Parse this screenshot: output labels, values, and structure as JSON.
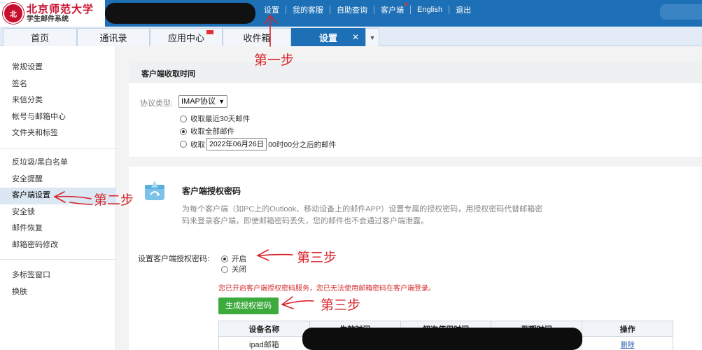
{
  "logo": {
    "title": "北京师范大学",
    "subtitle": "学生邮件系统"
  },
  "topnav": [
    "设置",
    "我的客服",
    "自助查询",
    "客户端",
    "English",
    "退出"
  ],
  "tabs": [
    "首页",
    "通讯录",
    "应用中心",
    "收件箱",
    "设置"
  ],
  "sidebar": {
    "group1": [
      "常规设置",
      "签名",
      "来信分类",
      "帐号与邮箱中心",
      "文件夹和标签"
    ],
    "group2": [
      "反垃圾/黑白名单",
      "安全提醒",
      "客户端设置",
      "安全锁",
      "邮件恢复",
      "邮箱密码修改"
    ],
    "group3": [
      "多标签窗口",
      "换肤"
    ]
  },
  "receive": {
    "header": "客户端收取时间",
    "protocol_label": "协议类型:",
    "protocol_value": "IMAP协议",
    "option1": "收取最近30天邮件",
    "option2": "收取全部邮件",
    "option3_prefix": "收取",
    "option3_date": "2022年06月26日",
    "option3_suffix": "00时00分之后的邮件"
  },
  "auth": {
    "title": "客户端授权密码",
    "description": "为每个客户端（如PC上的Outlook、移动设备上的邮件APP）设置专属的授权密码，用授权密码代替邮箱密码来登录客户端，即使邮箱密码丢失，您的邮件也不会通过客户端泄露。",
    "setting_label": "设置客户端授权密码:",
    "on": "开启",
    "off": "关闭",
    "notice": "您已开启客户端授权密码服务，您已无法使用邮箱密码在客户端登录。",
    "generate_button": "生成授权密码"
  },
  "table": {
    "headers": [
      "设备名称",
      "生效时间",
      "初次使用时间",
      "到期时间",
      "操作"
    ],
    "rows": [
      {
        "device": "ipad邮箱",
        "action": "删除"
      }
    ]
  },
  "annotations": {
    "step1": "第一步",
    "step2": "第二步",
    "step3a": "第三步",
    "step3b": "第三步"
  },
  "colors": {
    "brand": "#1d6fb6",
    "annotation": "#d8232a",
    "button": "#3caa3c",
    "notice": "#d32f2f"
  }
}
